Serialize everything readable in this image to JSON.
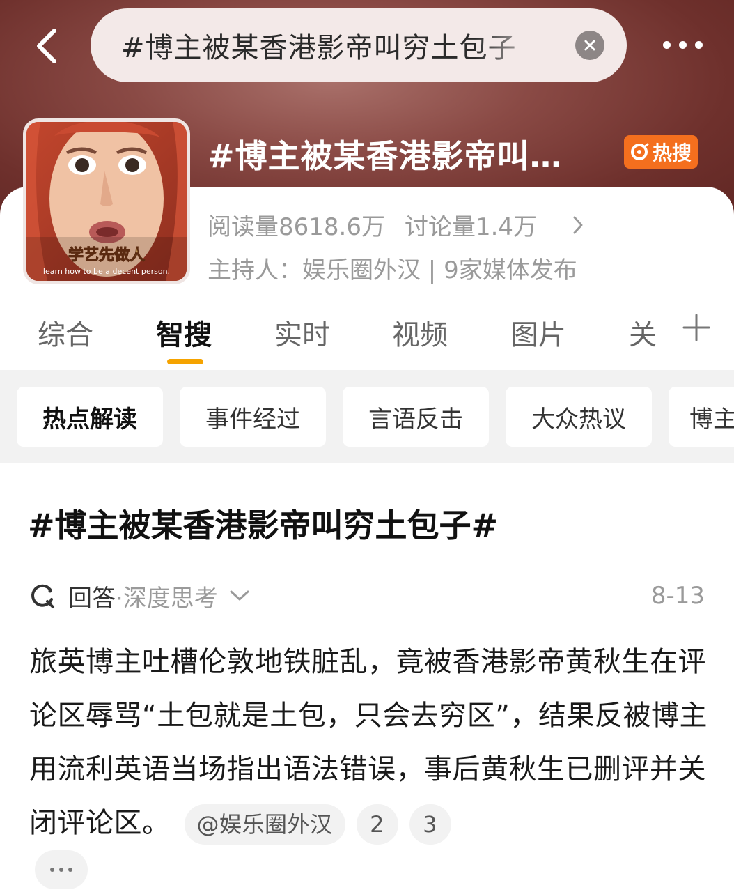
{
  "header": {
    "search_query": "#博主被某香港影帝叫穷土包子",
    "back_icon": "chevron-left-icon",
    "clear_icon": "close-circle-icon",
    "more_icon": "more-horizontal-icon"
  },
  "topic": {
    "title": "#博主被某香港影帝叫…",
    "badge": "热搜",
    "badge_color": "#f46f1e",
    "reads": "阅读量8618.6万",
    "discussions": "讨论量1.4万",
    "host": "主持人：娱乐圈外汉 | 9家媒体发布",
    "thumbnail": {
      "caption_cn": "学艺先做人",
      "caption_en": "learn how to be a decent person."
    }
  },
  "tabs": [
    {
      "label": "综合"
    },
    {
      "label": "智搜",
      "active": true
    },
    {
      "label": "实时"
    },
    {
      "label": "视频"
    },
    {
      "label": "图片"
    },
    {
      "label": "关"
    }
  ],
  "tab_accent": "#f5a300",
  "chips": [
    "热点解读",
    "事件经过",
    "言语反击",
    "大众热议",
    "博主"
  ],
  "answer": {
    "title": "#博主被某香港影帝叫穷土包子#",
    "label": "回答",
    "sublabel": "·深度思考",
    "date": "8-13",
    "body": "旅英博主吐槽伦敦地铁脏乱，竟被香港影帝黄秋生在评论区辱骂“土包就是土包，只会去穷区”，结果反被博主用流利英语当场指出语法错误，事后黄秋生已删评并关闭评论区。",
    "source": "@娱乐圈外汉",
    "refs": [
      "2",
      "3"
    ]
  }
}
